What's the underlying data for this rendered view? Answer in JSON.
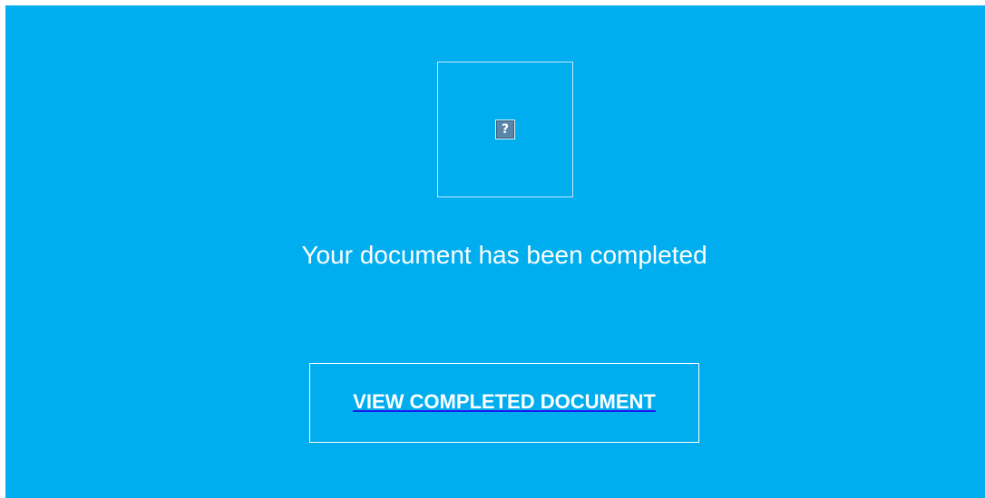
{
  "colors": {
    "panel_background": "#00aeef",
    "text": "#ffffff",
    "link_underline": "#1a1aee"
  },
  "image": {
    "icon": "broken-image-icon",
    "glyph": "?"
  },
  "message": {
    "text": "Your document has been completed"
  },
  "cta": {
    "label": "VIEW COMPLETED DOCUMENT"
  }
}
